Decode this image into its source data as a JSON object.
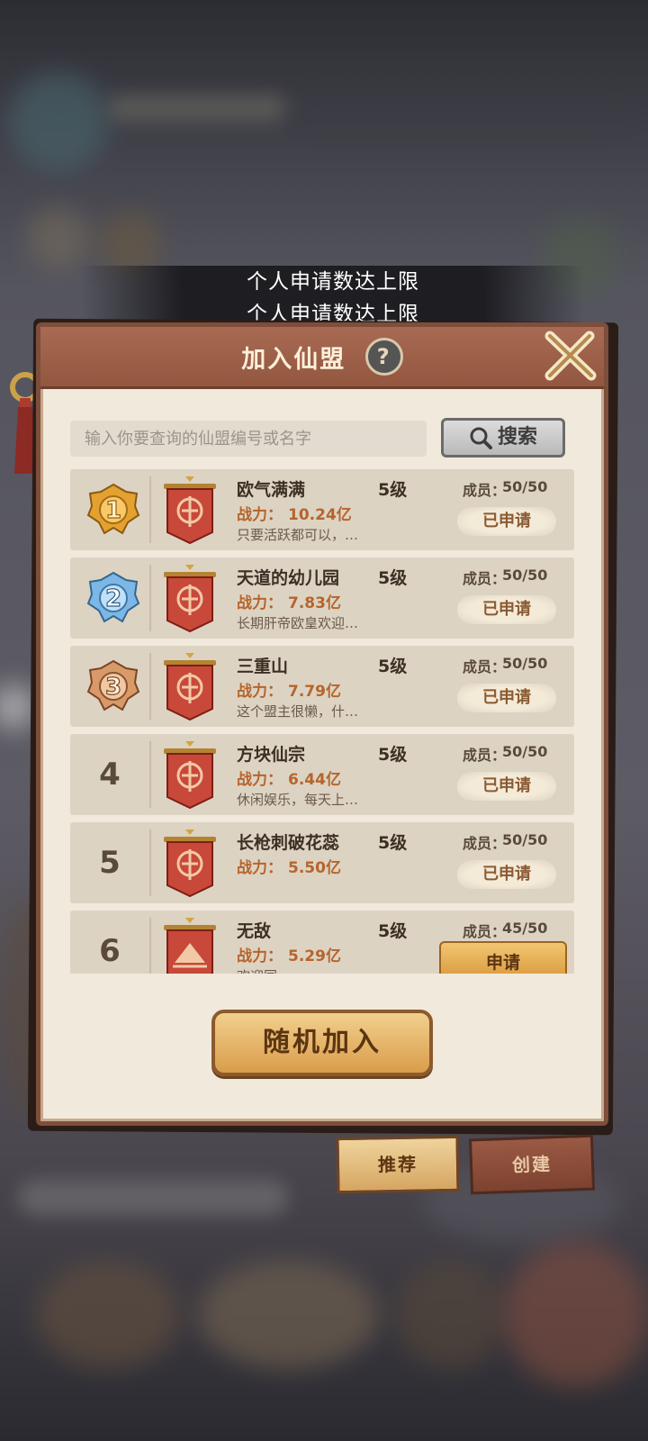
{
  "toasts": [
    "个人申请数达上限",
    "个人申请数达上限"
  ],
  "dialog": {
    "title": "加入仙盟",
    "help_icon": "?",
    "search": {
      "placeholder": "输入你要查询的仙盟编号或名字",
      "button_label": "搜索"
    },
    "power_label": "战力：",
    "members_label": "成员：",
    "guilds": [
      {
        "rank": "1",
        "name": "欧气满满",
        "level": "5级",
        "power": "10.24亿",
        "members": "50/50",
        "desc": "只要活跃都可以，…",
        "status": "已申请"
      },
      {
        "rank": "2",
        "name": "天道的幼儿园",
        "level": "5级",
        "power": "7.83亿",
        "members": "50/50",
        "desc": "长期肝帝欧皇欢迎…",
        "status": "已申请"
      },
      {
        "rank": "3",
        "name": "三重山",
        "level": "5级",
        "power": "7.79亿",
        "members": "50/50",
        "desc": "这个盟主很懒，什…",
        "status": "已申请"
      },
      {
        "rank": "4",
        "name": "方块仙宗",
        "level": "5级",
        "power": "6.44亿",
        "members": "50/50",
        "desc": "休闲娱乐，每天上…",
        "status": "已申请"
      },
      {
        "rank": "5",
        "name": "长枪刺破花蕊",
        "level": "5级",
        "power": "5.50亿",
        "members": "50/50",
        "desc": "",
        "status": "已申请"
      },
      {
        "rank": "6",
        "name": "无敌",
        "level": "5级",
        "power": "5.29亿",
        "members": "45/50",
        "desc": "欢迎同…",
        "status": "申请"
      }
    ],
    "random_join_label": "随机加入"
  },
  "tabs": {
    "recommend": "推荐",
    "create": "创建"
  }
}
